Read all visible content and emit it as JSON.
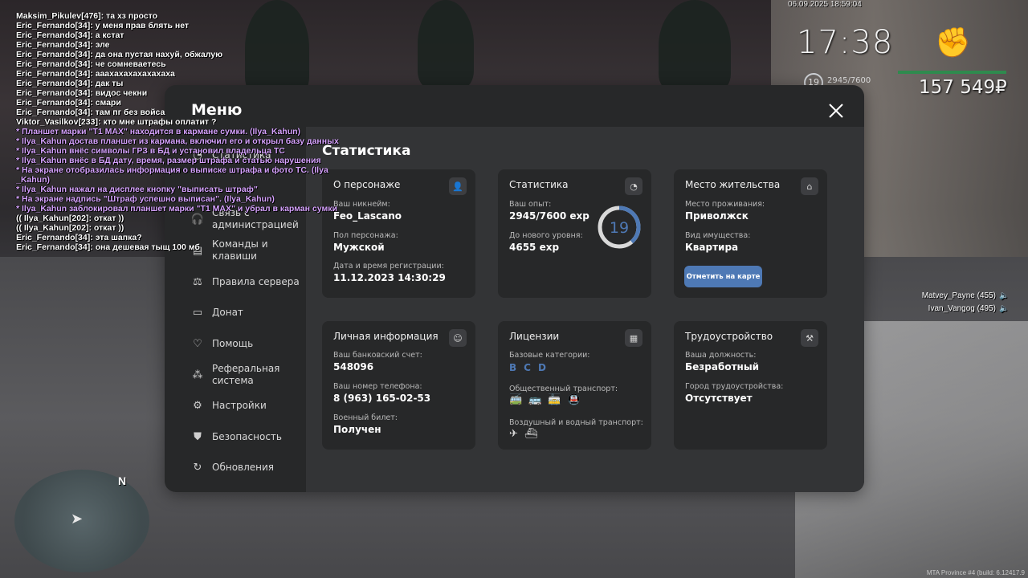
{
  "chat": [
    {
      "t": "Maksim_Pikulev[476]: та хз просто",
      "c": "w"
    },
    {
      "t": "Eric_Fernando[34]: у меня прав блять нет",
      "c": "w"
    },
    {
      "t": "Eric_Fernando[34]: а кстат",
      "c": "w"
    },
    {
      "t": "Eric_Fernando[34]: эле",
      "c": "w"
    },
    {
      "t": "Eric_Fernando[34]: да она пустая нахуй, обжалую",
      "c": "w"
    },
    {
      "t": "Eric_Fernando[34]: че сомневаетесь",
      "c": "w"
    },
    {
      "t": "Eric_Fernando[34]: аааxaxaxaxaxaxaxa",
      "c": "w"
    },
    {
      "t": "Eric_Fernando[34]: дак ты",
      "c": "w"
    },
    {
      "t": "Eric_Fernando[34]: видос чекни",
      "c": "w"
    },
    {
      "t": "Eric_Fernando[34]: смари",
      "c": "w"
    },
    {
      "t": "Eric_Fernando[34]: там пг без войса",
      "c": "w"
    },
    {
      "t": "Viktor_Vasilkov[233]: кто мне штрафы оплатит ?",
      "c": "w"
    },
    {
      "t": "* Планшет марки \"T1 MAX\" находится в кармане сумки. (Ilya_Kahun)",
      "c": "p"
    },
    {
      "t": "* Ilya_Kahun достав планшет из кармана, включил его и открыл базу данных",
      "c": "p"
    },
    {
      "t": "* Ilya_Kahun внёс символы ГРЗ в БД и установил владельца ТС",
      "c": "p"
    },
    {
      "t": "* Ilya_Kahun внёс в БД дату, время, размер штрафа и статью нарушения",
      "c": "p"
    },
    {
      "t": "* На экране отобразилась информация о выписке штрафа и фото ТС. (Ilya",
      "c": "p"
    },
    {
      "t": "_Kahun)",
      "c": "p"
    },
    {
      "t": "* Ilya_Kahun нажал на дисплее кнопку \"выписать штраф\"",
      "c": "p"
    },
    {
      "t": "* На экране надпись \"Штраф успешно выписан\". (Ilya_Kahun)",
      "c": "p"
    },
    {
      "t": "* Ilya_Kahun заблокировал планшет марки \"T1 MAX\" и убрал в карман сумки",
      "c": "p"
    },
    {
      "t": "(( Ilya_Kahun[202]: откат ))",
      "c": "w"
    },
    {
      "t": "(( Ilya_Kahun[202]: откат ))",
      "c": "w"
    },
    {
      "t": "Eric_Fernando[34]: эта шапка?",
      "c": "w"
    },
    {
      "t": "Eric_Fernando[34]: она дешевая тыщ 100 мб",
      "c": "w"
    }
  ],
  "hud": {
    "date": "06.09.2025 18:59:04",
    "time": "17:38",
    "level": "19",
    "exp": "2945/7600",
    "money": "157 549₽",
    "fist_icon": "fist-icon"
  },
  "players": [
    "Matvey_Payne (455)",
    "Ivan_Vangog (495)"
  ],
  "minimap": {
    "north": "N"
  },
  "build": "MTA Province #4 (build: 6.12417.9",
  "menu": {
    "title": "Меню",
    "sidebar": [
      {
        "label": "Статистика",
        "icon": "chart-icon"
      },
      {
        "label": "Связь с администрацией",
        "icon": "headset-icon"
      },
      {
        "label": "Команды и клавиши",
        "icon": "document-icon"
      },
      {
        "label": "Правила сервера",
        "icon": "scales-icon"
      },
      {
        "label": "Донат",
        "icon": "wallet-icon"
      },
      {
        "label": "Помощь",
        "icon": "heart-hand-icon"
      },
      {
        "label": "Реферальная система",
        "icon": "network-icon"
      },
      {
        "label": "Настройки",
        "icon": "gear-icon"
      },
      {
        "label": "Безопасность",
        "icon": "shield-icon"
      },
      {
        "label": "Обновления",
        "icon": "refresh-icon"
      }
    ],
    "content_title": "Статистика",
    "cards": {
      "character": {
        "title": "О персонаже",
        "nick_label": "Ваш никнейм:",
        "nick": "Feo_Lascano",
        "gender_label": "Пол персонажа:",
        "gender": "Мужской",
        "reg_label": "Дата и время регистрации:",
        "reg": "11.12.2023 14:30:29"
      },
      "stats": {
        "title": "Статистика",
        "exp_label": "Ваш опыт:",
        "exp": "2945/7600 exp",
        "next_label": "До нового уровня:",
        "next": "4655 exp",
        "level": "19",
        "progress": 0.3875
      },
      "residence": {
        "title": "Место жительства",
        "place_label": "Место проживания:",
        "place": "Приволжск",
        "property_label": "Вид имущества:",
        "property": "Квартира",
        "map_button": "Отметить на карте"
      },
      "personal": {
        "title": "Личная информация",
        "bank_label": "Ваш банковский счет:",
        "bank": "548096",
        "phone_label": "Ваш номер телефона:",
        "phone": "8 (963) 165-02-53",
        "military_label": "Военный билет:",
        "military": "Получен"
      },
      "licenses": {
        "title": "Лицензии",
        "base_label": "Базовые категории:",
        "base": [
          "B",
          "C",
          "D"
        ],
        "public_label": "Общественный транспорт:",
        "air_label": "Воздушный и водный транспорт:"
      },
      "employment": {
        "title": "Трудоустройство",
        "position_label": "Ваша должность:",
        "position": "Безработный",
        "city_label": "Город трудоустройства:",
        "city": "Отсутствует"
      }
    }
  }
}
